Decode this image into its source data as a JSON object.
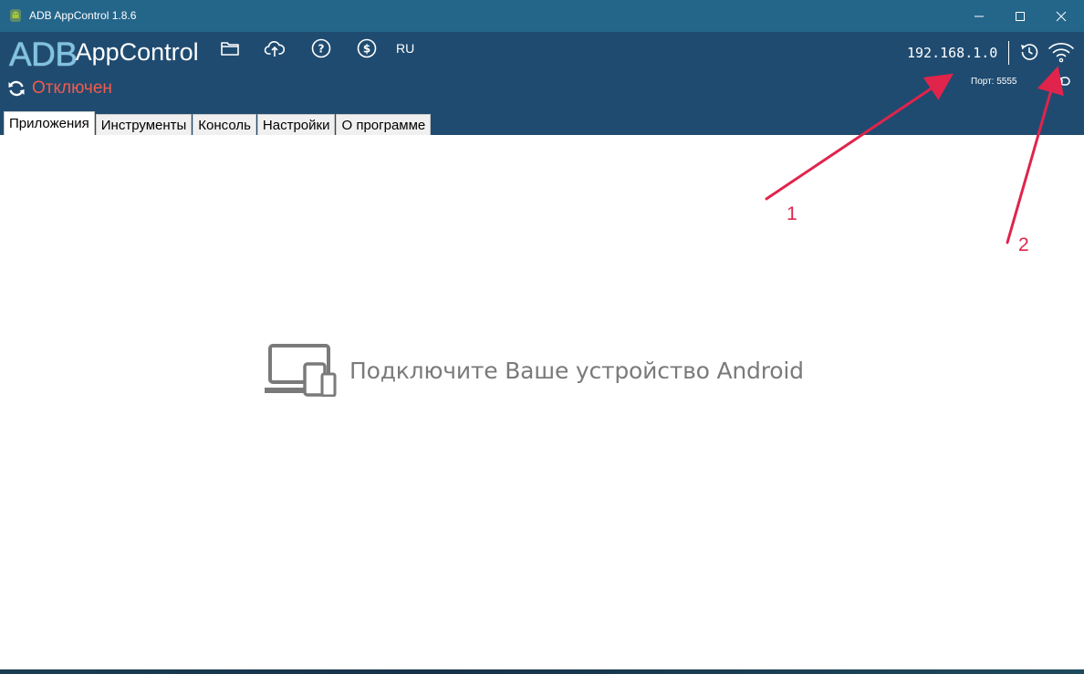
{
  "window": {
    "title": "ADB AppControl 1.8.6",
    "titlebar_color": "#24658a",
    "header_color": "#1f4b70"
  },
  "header": {
    "logo_adb": "ADB",
    "logo_appcontrol": "AppControl",
    "lang": "RU",
    "icons": [
      "folder-icon",
      "cloud-upload-icon",
      "help-icon",
      "dollar-icon"
    ],
    "ip_value": "192.168.1.0",
    "port_label": "Порт: 5555",
    "status": "Отключен",
    "status_color": "#f25b4b"
  },
  "tabs": [
    {
      "label": "Приложения",
      "active": true
    },
    {
      "label": "Инструменты",
      "active": false
    },
    {
      "label": "Консоль",
      "active": false
    },
    {
      "label": "Настройки",
      "active": false
    },
    {
      "label": "О программе",
      "active": false
    }
  ],
  "main": {
    "message": "Подключите Ваше устройство Android"
  },
  "annotations": {
    "label_1": "1",
    "label_2": "2",
    "arrow_color": "#e0244c"
  }
}
